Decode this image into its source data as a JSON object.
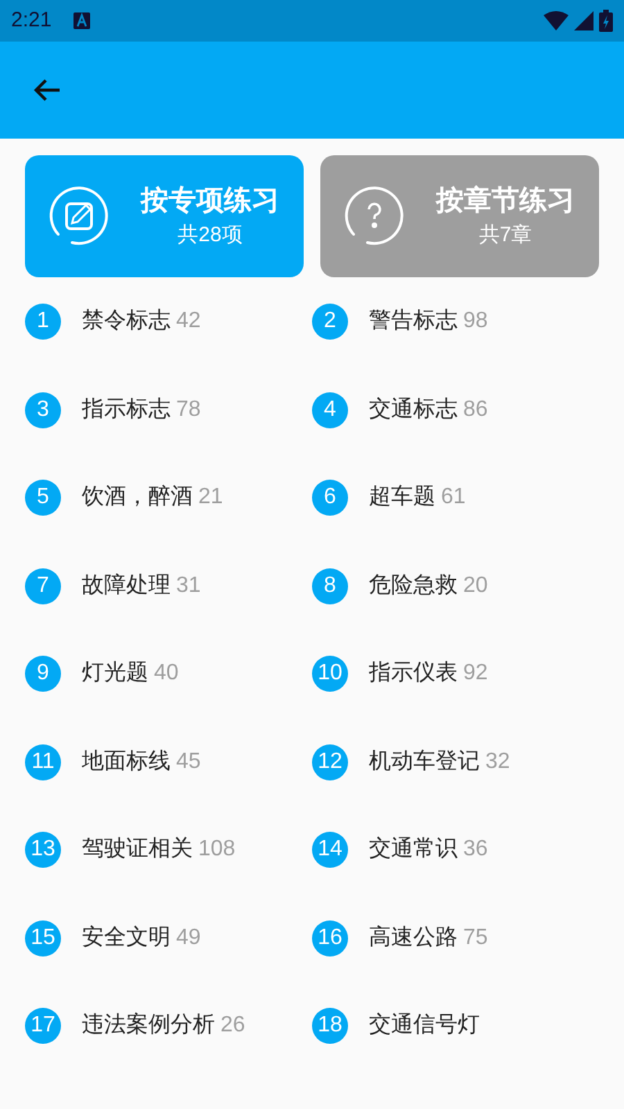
{
  "status_bar": {
    "time": "2:21"
  },
  "modes": [
    {
      "title": "按专项练习",
      "subtitle": "共28项",
      "kind": "topic",
      "selected": true
    },
    {
      "title": "按章节练习",
      "subtitle": "共7章",
      "kind": "chapter",
      "selected": false
    }
  ],
  "topics": [
    {
      "number": "1",
      "name": "禁令标志",
      "count": "42"
    },
    {
      "number": "2",
      "name": "警告标志",
      "count": "98"
    },
    {
      "number": "3",
      "name": "指示标志",
      "count": "78"
    },
    {
      "number": "4",
      "name": "交通标志",
      "count": "86"
    },
    {
      "number": "5",
      "name": "饮酒，醉酒",
      "count": "21"
    },
    {
      "number": "6",
      "name": "超车题",
      "count": "61"
    },
    {
      "number": "7",
      "name": "故障处理",
      "count": "31"
    },
    {
      "number": "8",
      "name": "危险急救",
      "count": "20"
    },
    {
      "number": "9",
      "name": "灯光题",
      "count": "40"
    },
    {
      "number": "10",
      "name": "指示仪表",
      "count": "92"
    },
    {
      "number": "11",
      "name": "地面标线",
      "count": "45"
    },
    {
      "number": "12",
      "name": "机动车登记",
      "count": "32"
    },
    {
      "number": "13",
      "name": "驾驶证相关",
      "count": "108"
    },
    {
      "number": "14",
      "name": "交通常识",
      "count": "36"
    },
    {
      "number": "15",
      "name": "安全文明",
      "count": "49"
    },
    {
      "number": "16",
      "name": "高速公路",
      "count": "75"
    },
    {
      "number": "17",
      "name": "违法案例分析",
      "count": "26"
    },
    {
      "number": "18",
      "name": "交通信号灯"
    }
  ]
}
